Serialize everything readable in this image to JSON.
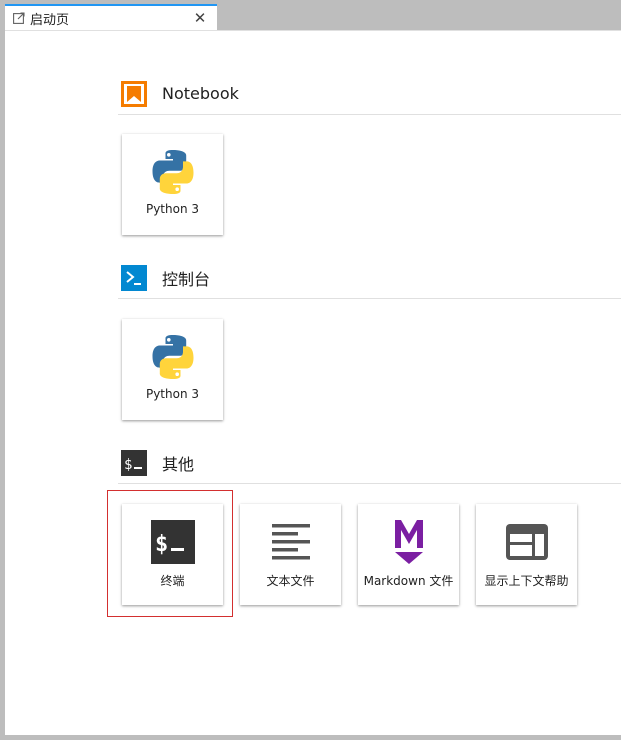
{
  "tab": {
    "title": "启动页",
    "close_glyph": "✕",
    "icon": "launcher-icon"
  },
  "sections": [
    {
      "title": "Notebook",
      "icon": "notebook-icon",
      "accent": "#f57c00",
      "items": [
        {
          "label": "Python 3",
          "icon": "python-icon"
        }
      ]
    },
    {
      "title": "控制台",
      "icon": "console-icon",
      "accent": "#0288d1",
      "items": [
        {
          "label": "Python 3",
          "icon": "python-icon"
        }
      ]
    },
    {
      "title": "其他",
      "icon": "terminal-icon",
      "accent": "#333333",
      "items": [
        {
          "label": "终端",
          "icon": "terminal-icon"
        },
        {
          "label": "文本文件",
          "icon": "text-file-icon"
        },
        {
          "label": "Markdown 文件",
          "icon": "markdown-icon"
        },
        {
          "label": "显示上下文帮助",
          "icon": "context-help-icon"
        }
      ]
    }
  ],
  "highlight_color": "#d32f2f"
}
